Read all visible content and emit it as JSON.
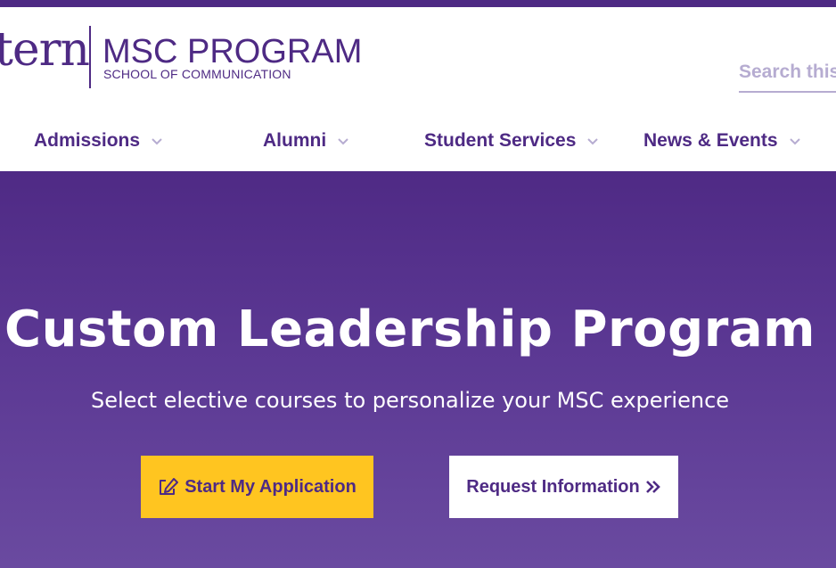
{
  "header": {
    "logo_wordmark": "tern",
    "logo_title": "MSC PROGRAM",
    "logo_subtitle": "SCHOOL OF COMMUNICATION",
    "search": {
      "placeholder": "Search this site"
    }
  },
  "nav": {
    "items": [
      {
        "label": "Admissions"
      },
      {
        "label": "Alumni"
      },
      {
        "label": "Student Services"
      },
      {
        "label": "News & Events"
      }
    ]
  },
  "hero": {
    "title": "Custom Leadership Program",
    "subtitle": "Select elective courses to personalize your MSC experience",
    "primary_button": {
      "label": "Start My Application",
      "icon": "edit-icon"
    },
    "secondary_button": {
      "label": "Request Information",
      "icon": "double-chevron-right-icon"
    }
  },
  "colors": {
    "brand_purple": "#4e2a84",
    "accent_yellow": "#ffc520",
    "light_purple": "#b6acd1",
    "white": "#ffffff"
  }
}
